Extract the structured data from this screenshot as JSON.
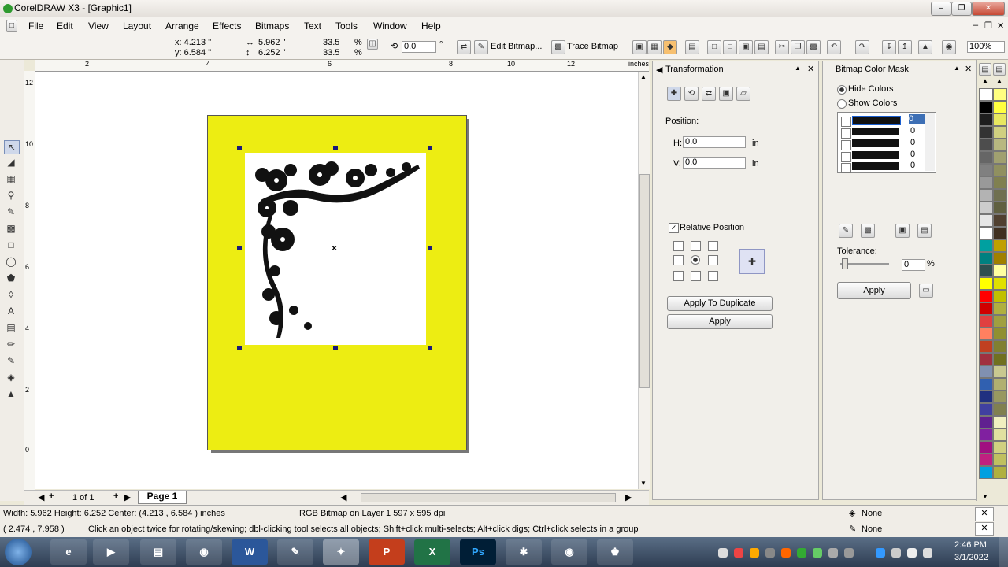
{
  "window": {
    "title": "CorelDRAW X3 - [Graphic1]"
  },
  "menu": [
    "File",
    "Edit",
    "View",
    "Layout",
    "Arrange",
    "Effects",
    "Bitmaps",
    "Text",
    "Tools",
    "Window",
    "Help"
  ],
  "propbar": {
    "x": "x: 4.213 \"",
    "y": "y: 6.584 \"",
    "width": "5.962 \"",
    "height": "6.252 \"",
    "scale_x": "33.5",
    "scale_y": "33.5",
    "pct": "%",
    "rotation": "0.0",
    "deg": "°",
    "edit_bitmap": "Edit Bitmap...",
    "trace_bitmap": "Trace Bitmap",
    "zoom": "100%"
  },
  "ruler": {
    "unit": "inches",
    "h_labels": [
      "2",
      "4",
      "6",
      "8",
      "10",
      "12"
    ],
    "v_labels": [
      "12",
      "10",
      "8",
      "6",
      "4",
      "2",
      "0"
    ]
  },
  "page_nav": {
    "counter": "1 of 1",
    "tab": "Page 1"
  },
  "transformation": {
    "title": "Transformation",
    "position_label": "Position:",
    "h_label": "H:",
    "h_value": "0.0",
    "v_label": "V:",
    "v_value": "0.0",
    "unit": "in",
    "relative_label": "Relative Position",
    "apply_duplicate": "Apply To Duplicate",
    "apply": "Apply"
  },
  "colormask": {
    "title": "Bitmap Color Mask",
    "hide": "Hide Colors",
    "show": "Show Colors",
    "rows": [
      "0",
      "0",
      "0",
      "0",
      "0"
    ],
    "tolerance_label": "Tolerance:",
    "tolerance_value": "0",
    "pct": "%",
    "apply": "Apply"
  },
  "status": {
    "dims": "Width: 5.962  Height: 6.252  Center: (4.213 , 6.584 )  inches",
    "layer": "RGB Bitmap on Layer 1 597 x 595 dpi",
    "coords": "( 2.474 , 7.958 )",
    "hint": "Click an object twice for rotating/skewing; dbl-clicking tool selects all objects; Shift+click multi-selects; Alt+click digs; Ctrl+click selects in a group",
    "fill": "None",
    "outline": "None"
  },
  "taskbar": {
    "time": "2:46 PM",
    "date": "3/1/2022"
  },
  "colors": {
    "page_yellow": "#eded12",
    "accent": "#3d6fb5"
  },
  "palette": [
    "#ffffff",
    "#000000",
    "#1e1e1e",
    "#333333",
    "#4d4d4d",
    "#666666",
    "#808080",
    "#999999",
    "#b3b3b3",
    "#cccccc",
    "#e6e6e6",
    "#ffffff",
    "#00a0a0",
    "#008080",
    "#2f4f4f",
    "#ffff00",
    "#ff0000",
    "#d00000",
    "#e04040",
    "#ff8060",
    "#c04020",
    "#a03040",
    "#8090b0",
    "#3060b0",
    "#203080",
    "#4040a0",
    "#602090",
    "#8020a0",
    "#a01080",
    "#c02080",
    "#00a0e0"
  ],
  "palette2": [
    "#ffff80",
    "#ffff40",
    "#e8e860",
    "#d0d080",
    "#b8b880",
    "#a0a070",
    "#909060",
    "#808050",
    "#707050",
    "#606040",
    "#504030",
    "#403020",
    "#c0a000",
    "#a08000",
    "#ffffa0",
    "#e0e000",
    "#c0c000",
    "#b0b040",
    "#a0a040",
    "#909030",
    "#808030",
    "#707020",
    "#c8c890",
    "#b0b070",
    "#989860",
    "#808050",
    "#f0f0c0",
    "#e0e0a0",
    "#d0d080",
    "#c0c060",
    "#b0b040"
  ]
}
